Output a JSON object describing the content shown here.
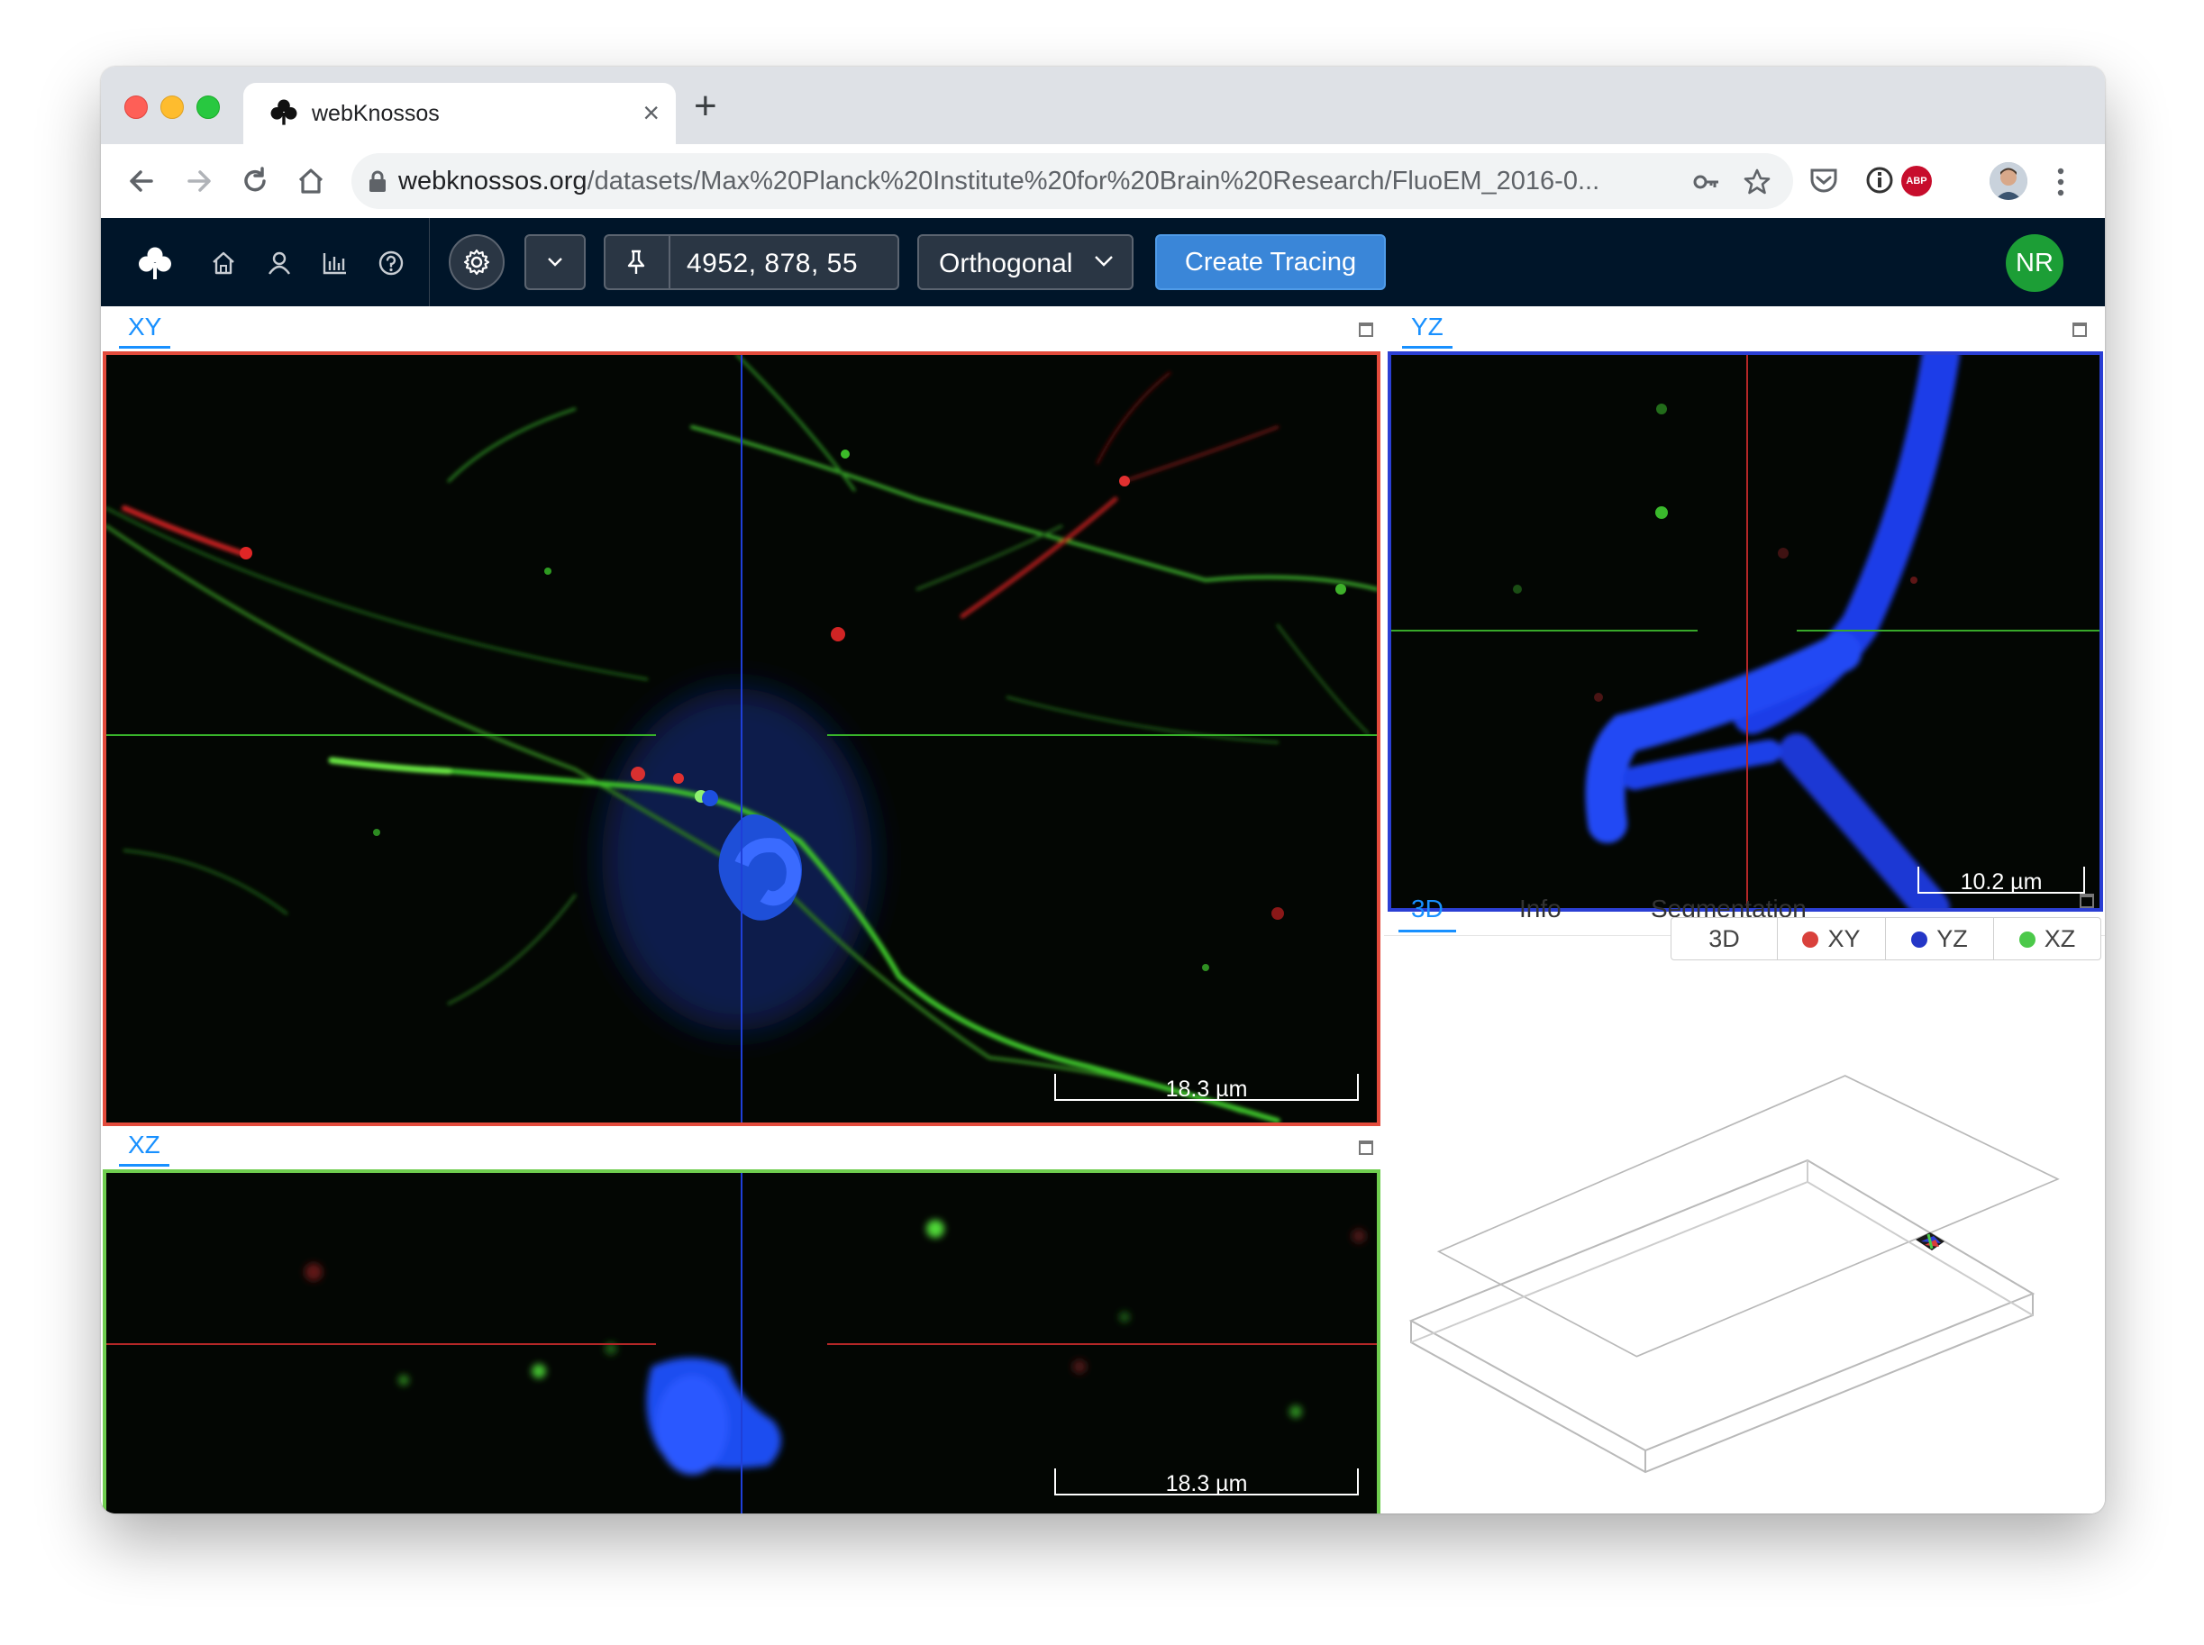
{
  "browser": {
    "tab_title": "webKnossos",
    "tab_close": "×",
    "new_tab": "+",
    "url_host": "webknossos.org",
    "url_path": "/datasets/Max%20Planck%20Institute%20for%20Brain%20Research/FluoEM_2016-0..."
  },
  "navbar": {
    "position": "4952, 878, 55",
    "view_mode": "Orthogonal",
    "create_tracing": "Create Tracing",
    "user_initials": "NR",
    "avatar_color": "#1c9e36",
    "background": "#001529"
  },
  "viewports": {
    "xy": {
      "label": "XY",
      "scale": "18.3 µm",
      "border_color": "#e34b3c"
    },
    "yz": {
      "label": "YZ",
      "scale": "10.2 µm",
      "border_color": "#2b3fd4"
    },
    "xz": {
      "label": "XZ",
      "scale": "18.3 µm",
      "border_color": "#6fcd4f"
    }
  },
  "panel3d": {
    "tabs": [
      "3D",
      "Info",
      "Segmentation"
    ],
    "buttons": [
      {
        "label": "3D",
        "dot": ""
      },
      {
        "label": "XY",
        "dot": "#d9413c"
      },
      {
        "label": "YZ",
        "dot": "#2436c7"
      },
      {
        "label": "XZ",
        "dot": "#4cc94a"
      }
    ]
  },
  "icons": [
    "clover-icon",
    "back-icon",
    "forward-icon",
    "reload-icon",
    "home-icon",
    "lock-icon",
    "key-icon",
    "star-icon",
    "pocket-icon",
    "info-icon",
    "abp-icon",
    "profile-icon",
    "kebab-icon",
    "user-icon",
    "stats-icon",
    "help-icon",
    "gear-icon",
    "chevron-down-icon",
    "pin-icon",
    "maximize-icon"
  ]
}
